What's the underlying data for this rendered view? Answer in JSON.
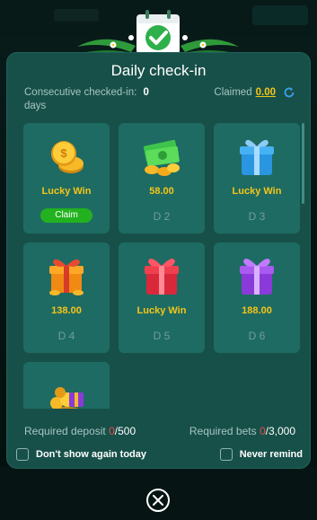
{
  "modal": {
    "title": "Daily check-in",
    "consecutive_label": "Consecutive checked-in:",
    "consecutive_value": "0",
    "consecutive_unit": "days",
    "claimed_label": "Claimed",
    "claimed_value": "0.00"
  },
  "days": [
    {
      "reward": "Lucky Win",
      "day": "",
      "action": "Claim",
      "icon": "gold-coins-icon"
    },
    {
      "reward": "58.00",
      "day": "D 2",
      "icon": "cash-coins-icon"
    },
    {
      "reward": "Lucky Win",
      "day": "D 3",
      "icon": "blue-gift-icon"
    },
    {
      "reward": "138.00",
      "day": "D 4",
      "icon": "orange-gift-icon"
    },
    {
      "reward": "Lucky Win",
      "day": "D 5",
      "icon": "red-gift-icon"
    },
    {
      "reward": "188.00",
      "day": "D 6",
      "icon": "purple-gift-icon"
    },
    {
      "reward": "",
      "day": "",
      "icon": "gold-treasure-gift-icon"
    }
  ],
  "requirements": {
    "deposit_label": "Required deposit",
    "deposit_current": "0",
    "deposit_total": "/500",
    "bets_label": "Required bets",
    "bets_current": "0",
    "bets_total": "/3,000"
  },
  "options": {
    "dont_show_today": "Don't show again today",
    "never_remind": "Never remind"
  },
  "colors": {
    "accent_gold": "#f5c518",
    "claim_green": "#23b21f",
    "modal_bg": "#175049",
    "card_bg": "#1e6b63",
    "required_red": "#e54b4b"
  },
  "icons": {
    "header": "checkmark-calendar-icon",
    "refresh": "refresh-icon",
    "close": "close-icon"
  }
}
